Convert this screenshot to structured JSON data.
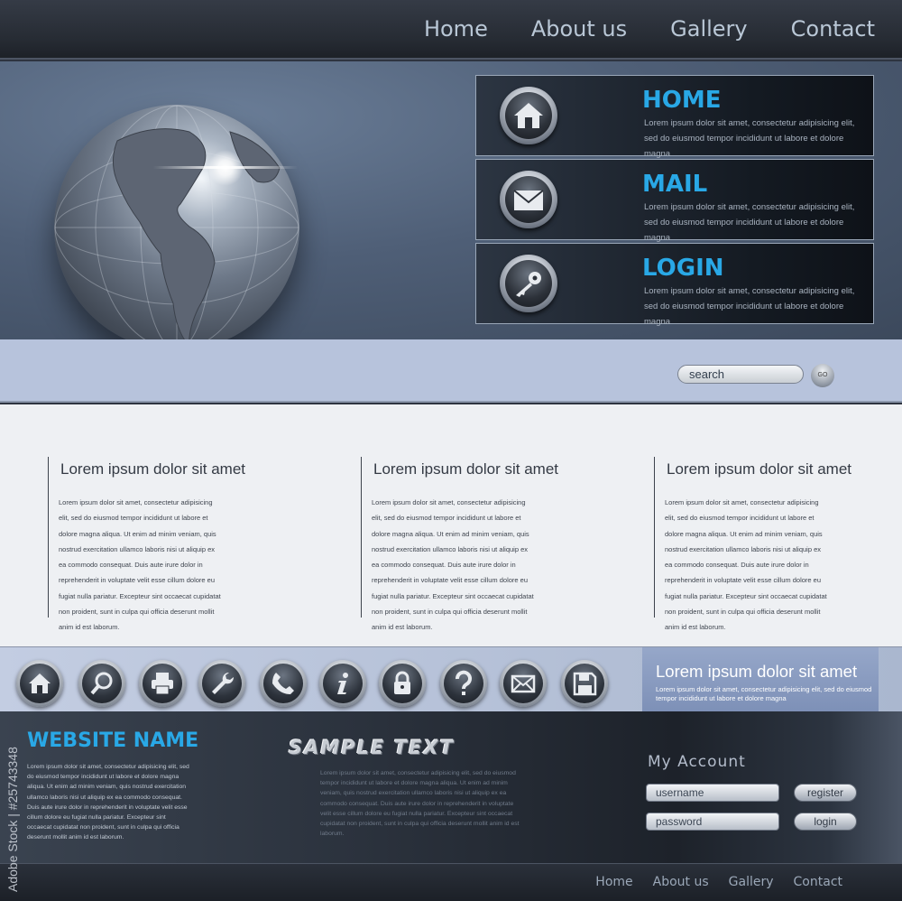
{
  "nav": {
    "items": [
      "Home",
      "About us",
      "Gallery",
      "Contact"
    ]
  },
  "hero": {
    "panels": [
      {
        "title": "HOME",
        "icon": "house-icon",
        "text": "Lorem ipsum dolor sit amet, consectetur adipisicing elit, sed do eiusmod tempor incididunt ut labore et dolore magna"
      },
      {
        "title": "MAIL",
        "icon": "envelope-icon",
        "text": "Lorem ipsum dolor sit amet, consectetur adipisicing elit, sed do eiusmod tempor incididunt ut labore et dolore magna"
      },
      {
        "title": "LOGIN",
        "icon": "key-icon",
        "text": "Lorem ipsum dolor sit amet, consectetur adipisicing elit, sed do eiusmod tempor incididunt ut labore et dolore magna"
      }
    ]
  },
  "search": {
    "placeholder": "search",
    "go_label": "GO"
  },
  "columns": [
    {
      "heading": "Lorem ipsum dolor sit amet",
      "text": "Lorem ipsum dolor sit amet, consectetur adipisicing elit, sed do eiusmod tempor incididunt ut labore et dolore magna aliqua. Ut enim ad minim veniam, quis nostrud exercitation ullamco laboris nisi ut aliquip ex ea commodo consequat. Duis aute irure dolor in reprehenderit in voluptate velit esse cillum dolore eu fugiat nulla pariatur. Excepteur sint occaecat cupidatat non proident, sunt in culpa qui officia deserunt mollit anim id est laborum."
    },
    {
      "heading": "Lorem ipsum dolor sit amet",
      "text": "Lorem ipsum dolor sit amet, consectetur adipisicing elit, sed do eiusmod tempor incididunt ut labore et dolore magna aliqua. Ut enim ad minim veniam, quis nostrud exercitation ullamco laboris nisi ut aliquip ex ea commodo consequat. Duis aute irure dolor in reprehenderit in voluptate velit esse cillum dolore eu fugiat nulla pariatur. Excepteur sint occaecat cupidatat non proident, sunt in culpa qui officia deserunt mollit anim id est laborum."
    },
    {
      "heading": "Lorem ipsum dolor sit amet",
      "text": "Lorem ipsum dolor sit amet, consectetur adipisicing elit, sed do eiusmod tempor incididunt ut labore et dolore magna aliqua. Ut enim ad minim veniam, quis nostrud exercitation ullamco laboris nisi ut aliquip ex ea commodo consequat. Duis aute irure dolor in reprehenderit in voluptate velit esse cillum dolore eu fugiat nulla pariatur. Excepteur sint occaecat cupidatat non proident, sunt in culpa qui officia deserunt mollit anim id est laborum."
    }
  ],
  "icon_bar": {
    "icons": [
      "home-icon",
      "search-icon",
      "printer-icon",
      "wrench-icon",
      "phone-icon",
      "info-icon",
      "lock-icon",
      "help-icon",
      "mail-icon",
      "save-icon"
    ],
    "promo_heading": "Lorem ipsum dolor sit amet",
    "promo_text": "Lorem ipsum dolor sit amet, consectetur adipisicing elit, sed do eiusmod tempor incididunt ut labore et dolore magna"
  },
  "footer": {
    "site_name": "WEBSITE NAME",
    "site_text": "Lorem ipsum dolor sit amet, consectetur adipisicing elit, sed do eiusmod tempor incididunt ut labore et dolore magna aliqua. Ut enim ad minim veniam, quis nostrud exercitation ullamco laboris nisi ut aliquip ex ea commodo consequat. Duis aute irure dolor in reprehenderit in voluptate velit esse cillum dolore eu fugiat nulla pariatur. Excepteur sint occaecat cupidatat non proident, sunt in culpa qui officia deserunt mollit anim id est laborum.",
    "sample_heading": "SAMPLE TEXT",
    "sample_text": "Lorem ipsum dolor sit amet, consectetur adipisicing elit, sed do eiusmod tempor incididunt ut labore et dolore magna aliqua. Ut enim ad minim veniam, quis nostrud exercitation ullamco laboris nisi ut aliquip ex ea commodo consequat. Duis aute irure dolor in reprehenderit in voluptate velit esse cillum dolore eu fugiat nulla pariatur. Excepteur sint occaecat cupidatat non proident, sunt in culpa qui officia deserunt mollit anim id est laborum.",
    "account_heading": "My Account",
    "username_placeholder": "username",
    "password_placeholder": "password",
    "register_label": "register",
    "login_label": "login",
    "bottom_nav": [
      "Home",
      "About us",
      "Gallery",
      "Contact"
    ]
  },
  "watermark": "Adobe Stock | #25743348",
  "colors": {
    "accent": "#29a8e6",
    "band": "#b7c3dc",
    "dark": "#1d222a"
  }
}
